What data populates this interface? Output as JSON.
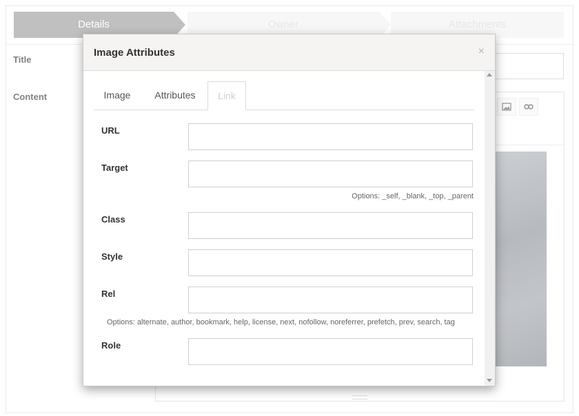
{
  "wizard": {
    "steps": [
      "Details",
      "Owner",
      "Attachments"
    ]
  },
  "form": {
    "title_label": "Title",
    "content_label": "Content"
  },
  "editor_toolbar": {
    "icons": [
      "image-icon",
      "link-icon"
    ]
  },
  "modal": {
    "title": "Image Attributes",
    "close_glyph": "×",
    "tabs": [
      {
        "label": "Image",
        "active": false
      },
      {
        "label": "Attributes",
        "active": false
      },
      {
        "label": "Link",
        "active": true
      }
    ],
    "fields": {
      "url": {
        "label": "URL",
        "value": ""
      },
      "target": {
        "label": "Target",
        "value": "",
        "hint": "Options: _self, _blank, _top, _parent"
      },
      "class": {
        "label": "Class",
        "value": ""
      },
      "style": {
        "label": "Style",
        "value": ""
      },
      "rel": {
        "label": "Rel",
        "value": "",
        "hint": "Options: alternate, author, bookmark, help, license, next, nofollow, noreferrer, prefetch, prev, search, tag"
      },
      "role": {
        "label": "Role",
        "value": ""
      }
    }
  },
  "colors": {
    "active_step": "#bdbdbd",
    "inactive_step": "#f7f7f7",
    "modal_header": "#f5f4f2"
  }
}
